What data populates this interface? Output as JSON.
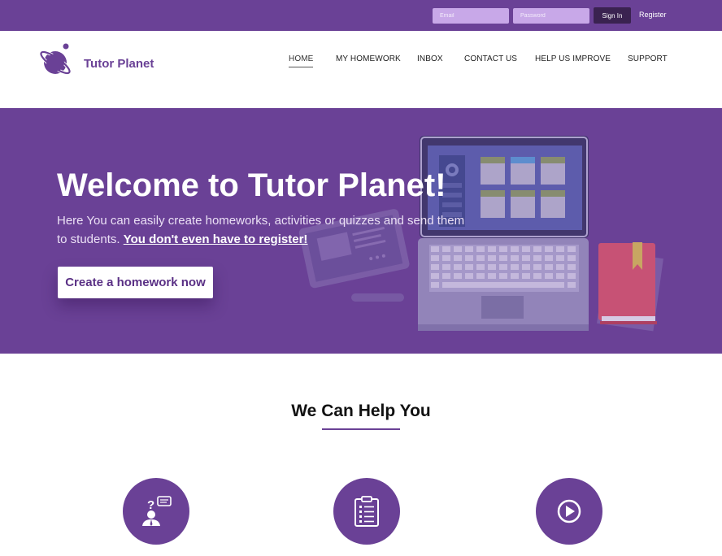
{
  "topbar": {
    "email_placeholder": "Email",
    "password_placeholder": "Password",
    "signin_label": "Sign In",
    "register_label": "Register"
  },
  "brand": {
    "name": "Tutor Planet"
  },
  "nav": {
    "items": [
      {
        "label": "HOME",
        "active": true
      },
      {
        "label": "MY HOMEWORK"
      },
      {
        "label": "INBOX"
      },
      {
        "label": "CONTACT US"
      },
      {
        "label": "HELP US IMPROVE"
      },
      {
        "label": "SUPPORT"
      }
    ]
  },
  "hero": {
    "title": "Welcome to Tutor Planet!",
    "subtitle": "Here You can easily create homeworks, activities or quizzes and send them to students.",
    "subtitle_link": "You don't even have to register!",
    "cta_label": "Create a homework now"
  },
  "help": {
    "title": "We Can Help You",
    "features": [
      {
        "icon": "question-person-icon"
      },
      {
        "icon": "clipboard-icon"
      },
      {
        "icon": "play-icon"
      }
    ]
  },
  "colors": {
    "primary": "#6a4196",
    "input_bg": "#c8a8e8",
    "signin_bg": "#3a2250",
    "white": "#ffffff"
  }
}
